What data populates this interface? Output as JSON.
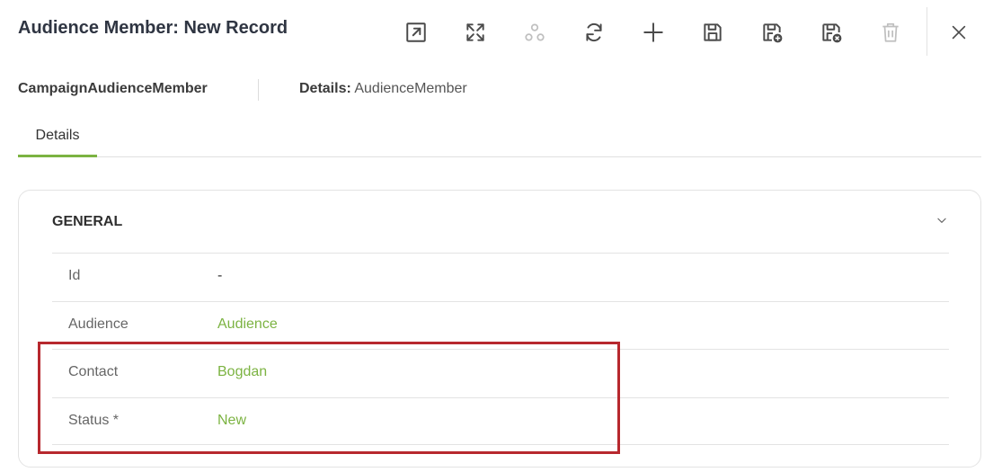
{
  "header": {
    "title": "Audience Member: New Record"
  },
  "toolbar": {
    "buttons": [
      {
        "icon": "open-external-icon",
        "disabled": false
      },
      {
        "icon": "maximize-icon",
        "disabled": false
      },
      {
        "icon": "hierarchy-icon",
        "disabled": true
      },
      {
        "icon": "refresh-icon",
        "disabled": false
      },
      {
        "icon": "add-icon",
        "disabled": false
      },
      {
        "icon": "save-icon",
        "disabled": false
      },
      {
        "icon": "save-and-new-icon",
        "disabled": false
      },
      {
        "icon": "save-and-close-icon",
        "disabled": false
      },
      {
        "icon": "delete-icon",
        "disabled": true
      }
    ],
    "close_icon": "close-icon"
  },
  "entity": {
    "name": "CampaignAudienceMember",
    "details_prefix": "Details:",
    "details_value": "AudienceMember"
  },
  "tabs": [
    {
      "label": "Details",
      "active": true
    }
  ],
  "section": {
    "title": "GENERAL",
    "rows": [
      {
        "label": "Id",
        "value": "-",
        "link": false
      },
      {
        "label": "Audience",
        "value": "Audience",
        "link": true
      },
      {
        "label": "Contact",
        "value": "Bogdan",
        "link": true
      },
      {
        "label": "Status *",
        "value": "New",
        "link": true
      }
    ]
  },
  "colors": {
    "accent": "#7cb342",
    "highlight": "#b7282e",
    "icon": "#4a4a4a"
  }
}
